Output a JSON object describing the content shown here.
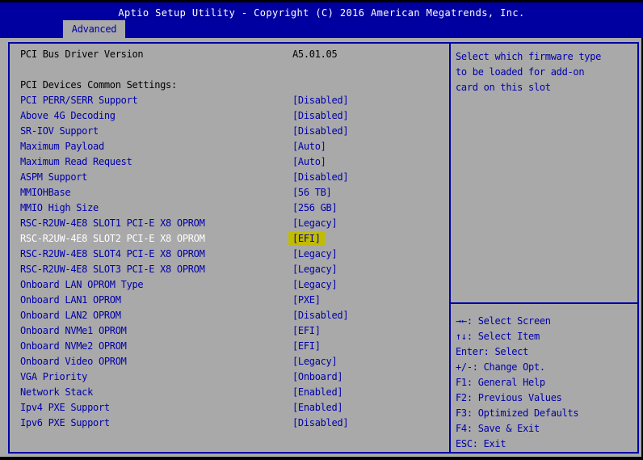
{
  "header": {
    "title": "Aptio Setup Utility - Copyright (C) 2016 American Megatrends, Inc.",
    "tab": "Advanced"
  },
  "settings": {
    "items": [
      {
        "kind": "static",
        "label": "PCI Bus Driver Version",
        "value": "A5.01.05"
      },
      {
        "kind": "spacer",
        "label": "",
        "value": ""
      },
      {
        "kind": "static",
        "label": "PCI Devices Common Settings:",
        "value": ""
      },
      {
        "kind": "option",
        "label": "PCI PERR/SERR Support",
        "value": "[Disabled]"
      },
      {
        "kind": "option",
        "label": "Above 4G Decoding",
        "value": "[Disabled]"
      },
      {
        "kind": "option",
        "label": "SR-IOV Support",
        "value": "[Disabled]"
      },
      {
        "kind": "option",
        "label": "Maximum Payload",
        "value": "[Auto]"
      },
      {
        "kind": "option",
        "label": "Maximum Read Request",
        "value": "[Auto]"
      },
      {
        "kind": "option",
        "label": "ASPM Support",
        "value": "[Disabled]"
      },
      {
        "kind": "option",
        "label": "MMIOHBase",
        "value": "[56 TB]"
      },
      {
        "kind": "option",
        "label": "MMIO High Size",
        "value": "[256 GB]"
      },
      {
        "kind": "option",
        "label": "RSC-R2UW-4E8 SLOT1 PCI-E X8 OPROM",
        "value": "[Legacy]"
      },
      {
        "kind": "option",
        "label": "RSC-R2UW-4E8 SLOT2 PCI-E X8 OPROM",
        "value": "[EFI]",
        "selected": true
      },
      {
        "kind": "option",
        "label": "RSC-R2UW-4E8 SLOT4 PCI-E X8 OPROM",
        "value": "[Legacy]"
      },
      {
        "kind": "option",
        "label": "RSC-R2UW-4E8 SLOT3 PCI-E X8 OPROM",
        "value": "[Legacy]"
      },
      {
        "kind": "option",
        "label": "Onboard LAN OPROM Type",
        "value": "[Legacy]"
      },
      {
        "kind": "option",
        "label": "Onboard LAN1 OPROM",
        "value": "[PXE]"
      },
      {
        "kind": "option",
        "label": "Onboard LAN2 OPROM",
        "value": "[Disabled]"
      },
      {
        "kind": "option",
        "label": "Onboard NVMe1 OPROM",
        "value": "[EFI]"
      },
      {
        "kind": "option",
        "label": "Onboard NVMe2 OPROM",
        "value": "[EFI]"
      },
      {
        "kind": "option",
        "label": "Onboard Video OPROM",
        "value": "[Legacy]"
      },
      {
        "kind": "option",
        "label": "VGA Priority",
        "value": "[Onboard]"
      },
      {
        "kind": "option",
        "label": "Network Stack",
        "value": "[Enabled]"
      },
      {
        "kind": "option",
        "label": "Ipv4 PXE Support",
        "value": "[Enabled]"
      },
      {
        "kind": "option",
        "label": "Ipv6 PXE Support",
        "value": "[Disabled]"
      }
    ]
  },
  "help": {
    "lines": [
      "Select which firmware type",
      "to be loaded for add-on",
      "card on this slot"
    ]
  },
  "legend": {
    "items": [
      "→←: Select Screen",
      "↑↓: Select Item",
      "Enter: Select",
      "+/-: Change Opt.",
      "F1: General Help",
      "F2: Previous Values",
      "F3: Optimized Defaults",
      "F4: Save & Exit",
      "ESC: Exit"
    ]
  },
  "colors": {
    "navy": "#0000A8",
    "header_blue": "#0000A0",
    "bg_gray": "#A9A9A9",
    "highlight_yellow": "#C2BC00",
    "selected_text": "#FFFFFF",
    "black_text": "#000000"
  }
}
